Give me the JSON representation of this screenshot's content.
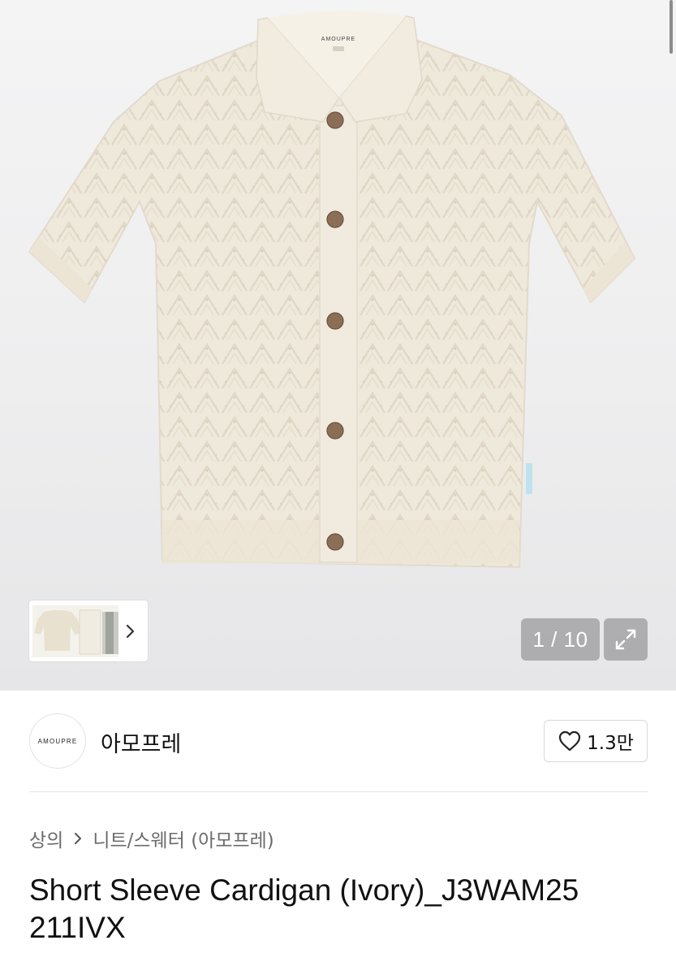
{
  "gallery": {
    "counter_current": "1",
    "counter_separator": " / ",
    "counter_total": "10",
    "garment_label": "AMOUPRE",
    "expand_icon": "expand-arrows-icon",
    "next_icon": "chevron-right-icon"
  },
  "brand": {
    "logo_text": "AMOUPRE",
    "name": "아모프레",
    "like_icon": "heart-outline-icon",
    "like_count": "1.3만"
  },
  "breadcrumb": {
    "items": [
      "상의",
      "니트/스웨터 (아모프레)"
    ],
    "separator_icon": "chevron-right-icon"
  },
  "product": {
    "title_line1": "Short Sleeve Cardigan (Ivory)_J3WAM25",
    "title_line2": "211IVX"
  },
  "colors": {
    "garment": "#efe9dc",
    "button": "#8a6e55",
    "overlay": "#7d7d80"
  }
}
